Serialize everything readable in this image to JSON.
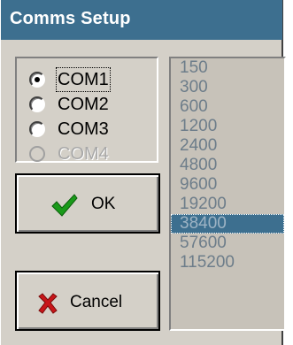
{
  "window": {
    "title": "Comms Setup"
  },
  "ports": [
    {
      "label": "COM1",
      "selected": true,
      "enabled": true,
      "focused": true
    },
    {
      "label": "COM2",
      "selected": false,
      "enabled": true,
      "focused": false
    },
    {
      "label": "COM3",
      "selected": false,
      "enabled": true,
      "focused": false
    },
    {
      "label": "COM4",
      "selected": false,
      "enabled": false,
      "focused": false
    }
  ],
  "buttons": {
    "ok_label": "OK",
    "cancel_label": "Cancel"
  },
  "baud_rates": [
    "150",
    "300",
    "600",
    "1200",
    "2400",
    "4800",
    "9600",
    "19200",
    "38400",
    "57600",
    "115200"
  ],
  "selected_baud": "38400",
  "colors": {
    "title_bar": "#3d6f8f",
    "selection": "#3d6f8f",
    "face": "#d4d0c8"
  }
}
